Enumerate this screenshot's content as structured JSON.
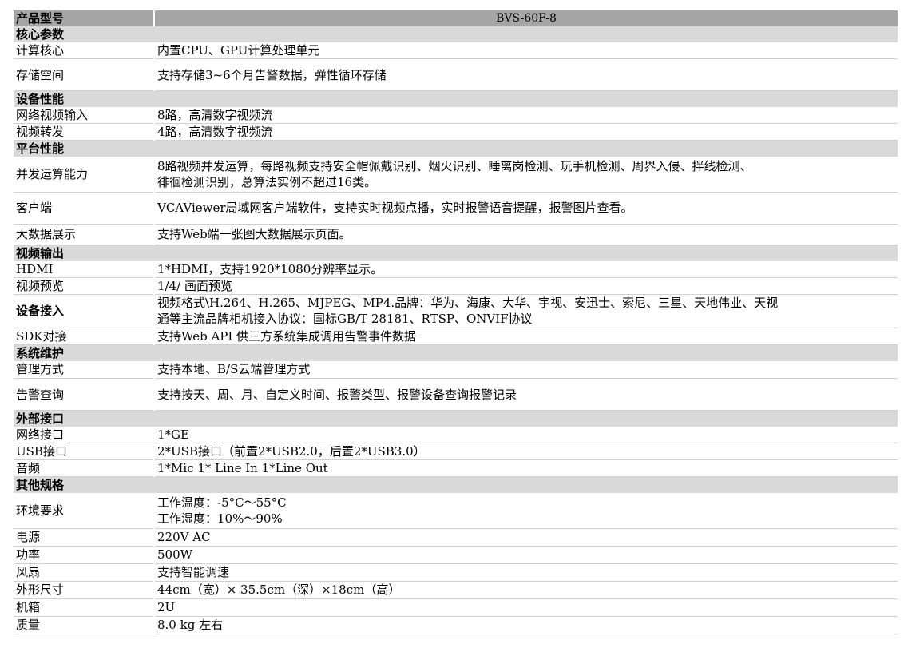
{
  "header": {
    "label": "产品型号",
    "value": "BVS-60F-8"
  },
  "sections": [
    {
      "title": "核心参数",
      "rows": [
        {
          "key": "计算核心",
          "value": "内置CPU、GPU计算处理单元"
        },
        {
          "key": "存储空间",
          "value": "支持存储3~6个月告警数据，弹性循环存储"
        }
      ]
    },
    {
      "title": "设备性能",
      "rows": [
        {
          "key": "网络视频输入",
          "value": "8路，高清数字视频流"
        },
        {
          "key": "视频转发",
          "value": "4路，高清数字视频流"
        }
      ]
    },
    {
      "title": "平台性能",
      "rows": [
        {
          "key": "并发运算能力",
          "value": "8路视频并发运算，每路视频支持安全帽佩戴识别、烟火识别、睡离岗检测、玩手机检测、周界入侵、拌线检测、",
          "value2": "徘徊检测识别，总算法实例不超过16类。"
        },
        {
          "key": "客户端",
          "value": "VCAViewer局域网客户端软件，支持实时视频点播，实时报警语音提醒，报警图片查看。"
        },
        {
          "key": "大数据展示",
          "value": "支持Web端一张图大数据展示页面。"
        }
      ]
    },
    {
      "title": "视频输出",
      "rows": [
        {
          "key": "HDMI",
          "value": "1*HDMI，支持1920*1080分辨率显示。"
        },
        {
          "key": "视频预览",
          "value": "1/4/ 画面预览"
        },
        {
          "key": "设备接入",
          "value": "视频格式\\H.264、H.265、MJPEG、MP4.品牌：华为、海康、大华、宇视、安迅士、索尼、三星、天地伟业、天视",
          "value2": "通等主流品牌相机接入协议：国标GB/T 28181、RTSP、ONVIF协议"
        },
        {
          "key": "SDK对接",
          "value": "支持Web API 供三方系统集成调用告警事件数据"
        }
      ]
    },
    {
      "title": "系统维护",
      "rows": [
        {
          "key": "管理方式",
          "value": "支持本地、B/S云端管理方式"
        },
        {
          "key": "告警查询",
          "value": "支持按天、周、月、自定义时间、报警类型、报警设备查询报警记录"
        }
      ]
    },
    {
      "title": "外部接口",
      "rows": [
        {
          "key": "网络接口",
          "value": "1*GE"
        },
        {
          "key": "USB接口",
          "value": "2*USB接口（前置2*USB2.0，后置2*USB3.0）"
        },
        {
          "key": "音频",
          "value": "1*Mic 1* Line In 1*Line Out"
        }
      ]
    },
    {
      "title": "其他规格",
      "rows": [
        {
          "key": "环境要求",
          "value": "工作温度：-5°C～55°C",
          "value2": "工作湿度：10%～90%"
        },
        {
          "key": "电源",
          "value": "220V AC"
        },
        {
          "key": "功率",
          "value": "500W"
        },
        {
          "key": "风扇",
          "value": "支持智能调速"
        },
        {
          "key": "外形尺寸",
          "value": "44cm（宽）× 35.5cm（深）×18cm（高）"
        },
        {
          "key": "机箱",
          "value": "2U"
        },
        {
          "key": "质量",
          "value": "8.0 kg 左右"
        }
      ]
    }
  ]
}
